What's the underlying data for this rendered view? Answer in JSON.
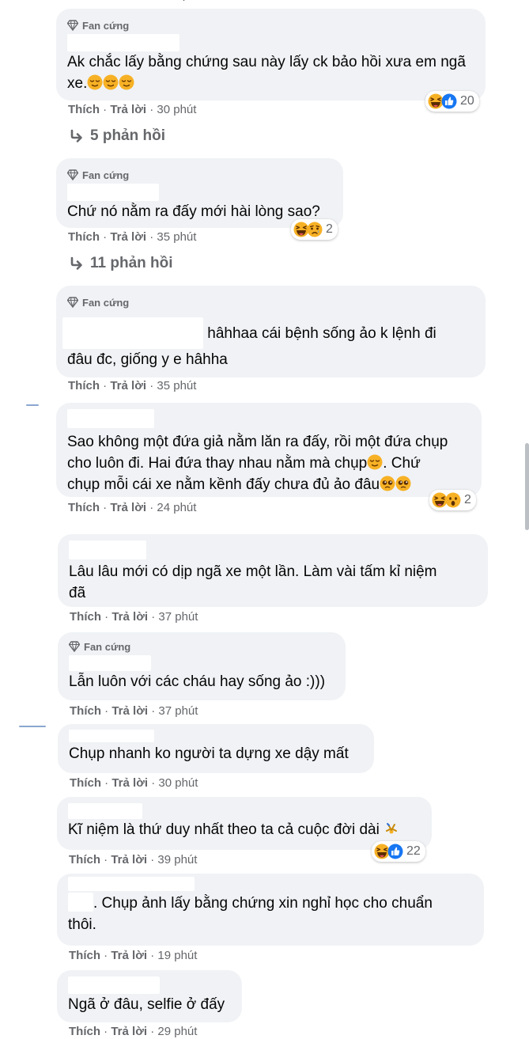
{
  "colors": {
    "bubble": "#f0f2f5",
    "meta": "#65676b",
    "text": "#050505",
    "like": "#1877f2",
    "haha": "#f7b125"
  },
  "top_fragment": "·",
  "comments": [
    {
      "badge": "Fan cứng",
      "text_a": "Ak chắc lấy bằng chứng sau này lấy ck bảo hồi xưa em ngã xe.",
      "text_emoji": [
        "relieved-emoji",
        "relieved-emoji",
        "relieved-emoji"
      ],
      "like": "Thích",
      "reply": "Trả lời",
      "time": "30 phút",
      "reactions": [
        "haha",
        "like"
      ],
      "count": "20",
      "replies": "5 phản hồi"
    },
    {
      "badge": "Fan cứng",
      "text_a": "Chứ nó nằm ra đấy mới hài lòng sao?",
      "like": "Thích",
      "reply": "Trả lời",
      "time": "35 phút",
      "reactions": [
        "haha",
        "sad"
      ],
      "count": "2",
      "replies": "11 phản hồi"
    },
    {
      "badge": "Fan cứng",
      "text_a": "hâhhaa cái bệnh sống ảo k lệnh đi",
      "text_b": "đâu đc, giống y e hâhha",
      "like": "Thích",
      "reply": "Trả lời",
      "time": "35 phút"
    },
    {
      "text_a": "Sao không một đứa giả nằm lăn ra đấy, rồi một đứa chụp",
      "text_b": "cho luôn đi. Hai đứa thay nhau nằm mà chụp",
      "text_c": ". Chứ",
      "text_d": "chụp mỗi cái xe nằm kềnh đấy chưa đủ ảo đâu",
      "like": "Thích",
      "reply": "Trả lời",
      "time": "24 phút",
      "reactions": [
        "haha",
        "wow"
      ],
      "count": "2"
    },
    {
      "text_a": "Lâu lâu mới có dịp ngã xe một lần. Làm vài tấm kỉ niệm",
      "text_b": "đã",
      "like": "Thích",
      "reply": "Trả lời",
      "time": "37 phút"
    },
    {
      "badge": "Fan cứng",
      "text_a": "Lẫn luôn với các cháu hay sống ảo :)))",
      "like": "Thích",
      "reply": "Trả lời",
      "time": "37 phút"
    },
    {
      "text_a": "Chụp nhanh ko người ta dựng xe dậy mất",
      "like": "Thích",
      "reply": "Trả lời",
      "time": "30 phút"
    },
    {
      "text_a": "Kĩ niệm là thứ duy nhất theo ta cả cuộc đời dài",
      "like": "Thích",
      "reply": "Trả lời",
      "time": "39 phút",
      "reactions": [
        "haha",
        "like"
      ],
      "count": "22"
    },
    {
      "text_a": ". Chụp ảnh lấy bằng chứng xin nghỉ học cho chuẩn",
      "text_b": "thôi.",
      "like": "Thích",
      "reply": "Trả lời",
      "time": "19 phút"
    },
    {
      "text_a": "Ngã ở đâu, selfie ở đấy",
      "like": "Thích",
      "reply": "Trả lời",
      "time": "29 phút"
    }
  ]
}
